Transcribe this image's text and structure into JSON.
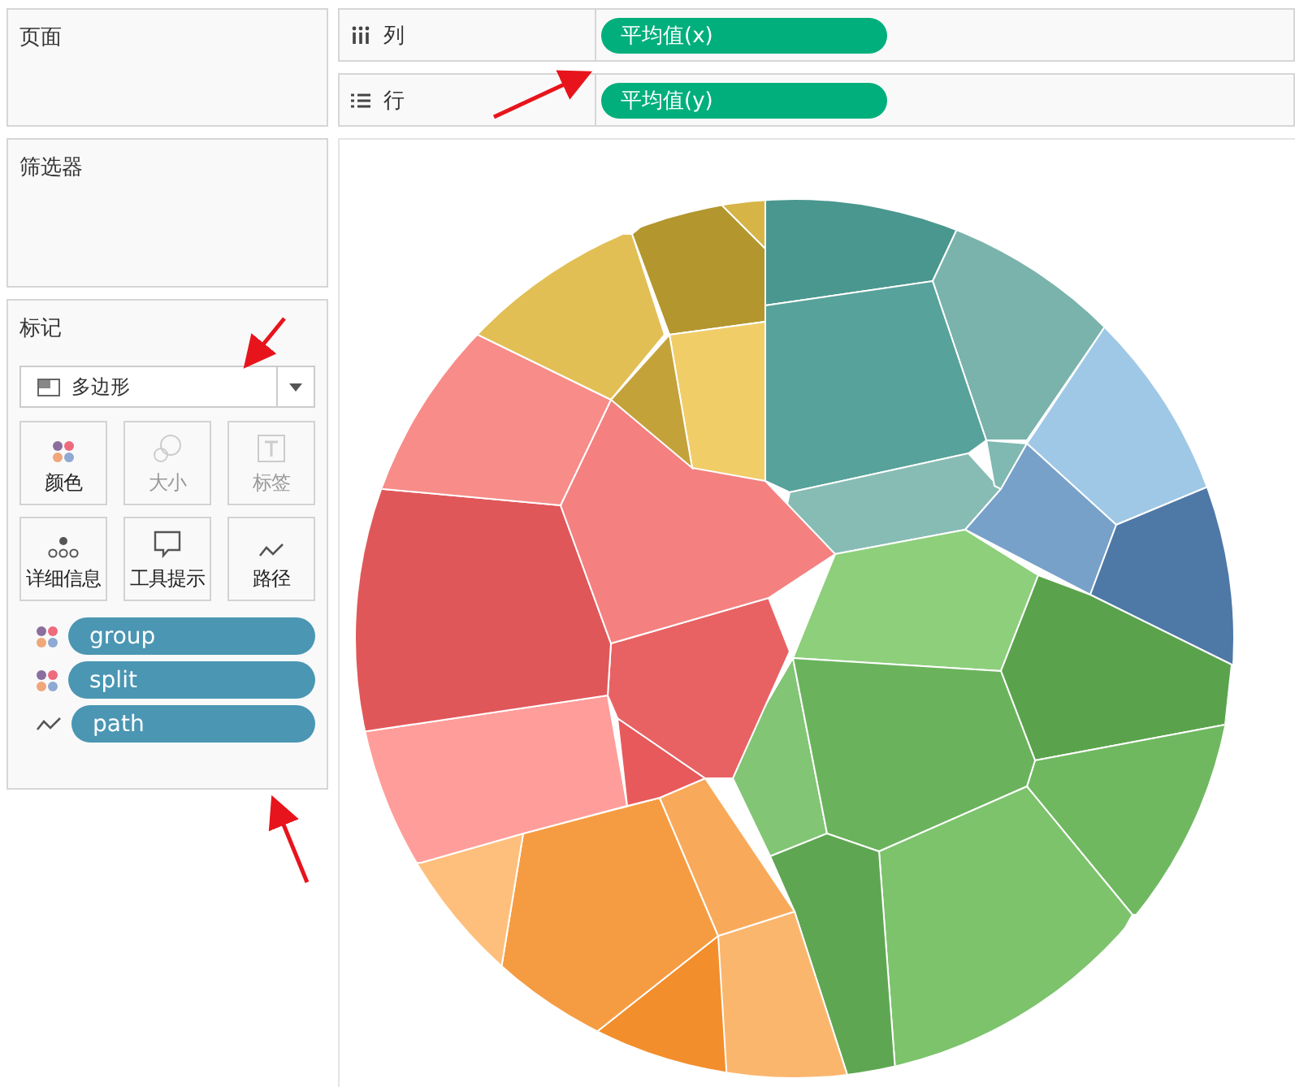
{
  "cards": {
    "pages": "页面",
    "filters": "筛选器",
    "marks": "标记"
  },
  "shelves": [
    {
      "kind": "columns",
      "label": "列",
      "pill": "平均值(x)"
    },
    {
      "kind": "rows",
      "label": "行",
      "pill": "平均值(y)"
    }
  ],
  "mark_type": {
    "label": "多边形"
  },
  "mark_buttons": [
    {
      "kind": "color",
      "label": "颜色",
      "disabled": false
    },
    {
      "kind": "size",
      "label": "大小",
      "disabled": true
    },
    {
      "kind": "text",
      "label": "标签",
      "disabled": true
    },
    {
      "kind": "detail",
      "label": "详细信息",
      "disabled": false
    },
    {
      "kind": "tooltip",
      "label": "工具提示",
      "disabled": false
    },
    {
      "kind": "path",
      "label": "路径",
      "disabled": false
    }
  ],
  "mark_fields": [
    {
      "kind": "color",
      "label": "group"
    },
    {
      "kind": "color",
      "label": "split"
    },
    {
      "kind": "path",
      "label": "path"
    }
  ]
}
